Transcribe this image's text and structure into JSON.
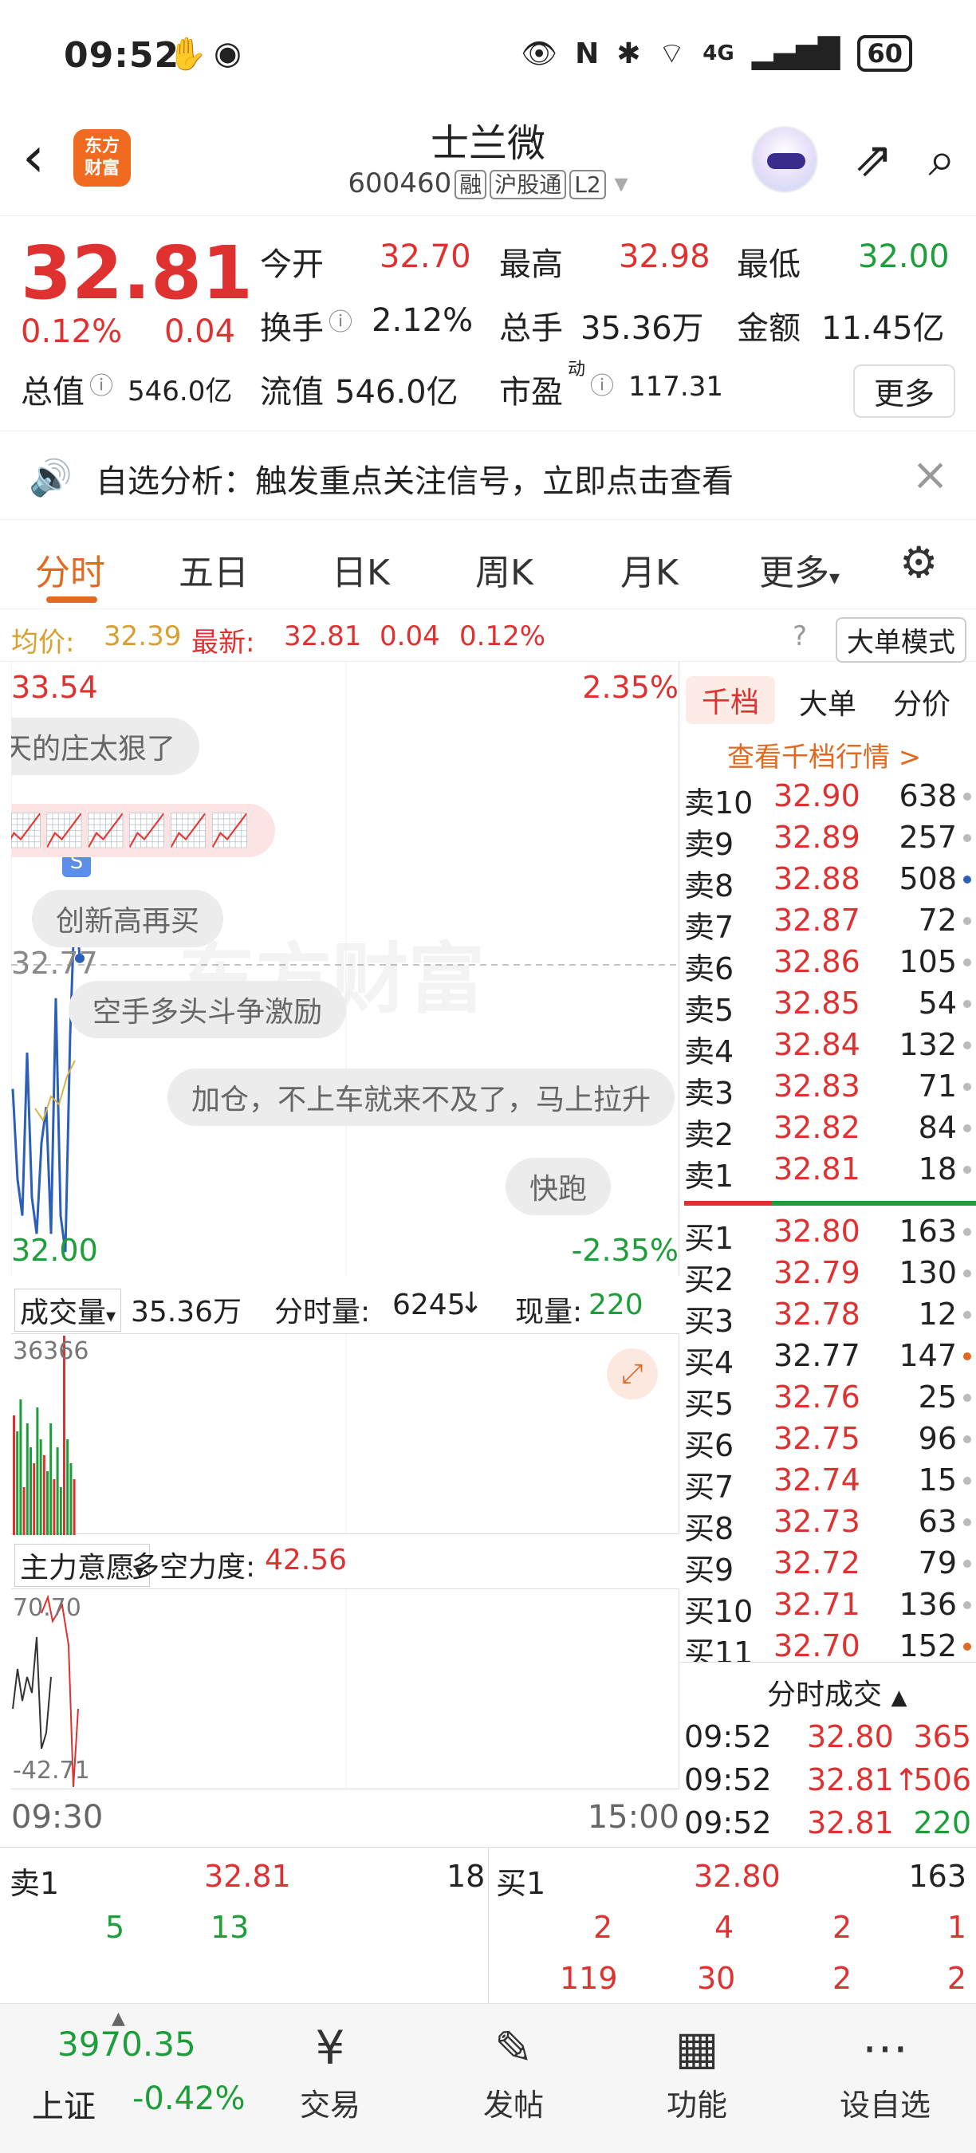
{
  "status_bar": {
    "time": "09:52",
    "network": "4G",
    "battery": "60"
  },
  "header": {
    "logo_line1": "东方",
    "logo_line2": "财富",
    "title": "士兰微",
    "code": "600460",
    "tags": [
      "融",
      "沪股通",
      "L2"
    ]
  },
  "quote": {
    "price": "32.81",
    "pct": "0.12%",
    "change": "0.04",
    "open_label": "今开",
    "open": "32.70",
    "high_label": "最高",
    "high": "32.98",
    "low_label": "最低",
    "low": "32.00",
    "turnover_label": "换手",
    "turnover": "2.12%",
    "volume_label": "总手",
    "volume": "35.36万",
    "amount_label": "金额",
    "amount": "11.45亿",
    "mktcap_label": "总值",
    "mktcap": "546.0亿",
    "float_label": "流值",
    "float": "546.0亿",
    "pe_label": "市盈",
    "pe_sup": "动",
    "pe": "117.31",
    "more": "更多"
  },
  "notice": {
    "text": "自选分析：触发重点关注信号，立即点击查看"
  },
  "tabs": [
    "分时",
    "五日",
    "日K",
    "周K",
    "月K",
    "更多"
  ],
  "avg_bar": {
    "avg_label": "均价:",
    "avg": "32.39",
    "latest_label": "最新:",
    "latest": "32.81",
    "chg": "0.04",
    "pct": "0.12%",
    "mode": "大单模式"
  },
  "chart": {
    "top_price": "33.54",
    "top_pct": "2.35%",
    "mid_price": "32.77",
    "bottom_price": "32.00",
    "bottom_pct": "-2.35%",
    "badge": "S",
    "watermark": "东方财富",
    "bubbles": [
      "天的庄太狠了",
      "创新高再买",
      "空手多头斗争激励",
      "加仓，不上车就来不及了，马上拉升",
      "快跑"
    ]
  },
  "volume_section": {
    "selector": "成交量",
    "total": "35.36万",
    "tick_label": "分时量:",
    "tick": "6245",
    "now_label": "现量:",
    "now": "220",
    "max": "36366"
  },
  "moneyflow_section": {
    "selector": "主力意愿",
    "strength_label": "多空力度:",
    "strength": "42.56",
    "top": "70.70",
    "bottom": "-42.71"
  },
  "time_axis": {
    "start": "09:30",
    "end": "15:00"
  },
  "orderbook": {
    "tabs": [
      "千档",
      "大单",
      "分价"
    ],
    "link": "查看千档行情 >",
    "asks": [
      {
        "label": "卖10",
        "price": "32.90",
        "vol": "638"
      },
      {
        "label": "卖9",
        "price": "32.89",
        "vol": "257"
      },
      {
        "label": "卖8",
        "price": "32.88",
        "vol": "508"
      },
      {
        "label": "卖7",
        "price": "32.87",
        "vol": "72"
      },
      {
        "label": "卖6",
        "price": "32.86",
        "vol": "105"
      },
      {
        "label": "卖5",
        "price": "32.85",
        "vol": "54"
      },
      {
        "label": "卖4",
        "price": "32.84",
        "vol": "132"
      },
      {
        "label": "卖3",
        "price": "32.83",
        "vol": "71"
      },
      {
        "label": "卖2",
        "price": "32.82",
        "vol": "84"
      },
      {
        "label": "卖1",
        "price": "32.81",
        "vol": "18"
      }
    ],
    "bids": [
      {
        "label": "买1",
        "price": "32.80",
        "vol": "163"
      },
      {
        "label": "买2",
        "price": "32.79",
        "vol": "130"
      },
      {
        "label": "买3",
        "price": "32.78",
        "vol": "12"
      },
      {
        "label": "买4",
        "price": "32.77",
        "vol": "147"
      },
      {
        "label": "买5",
        "price": "32.76",
        "vol": "25"
      },
      {
        "label": "买6",
        "price": "32.75",
        "vol": "96"
      },
      {
        "label": "买7",
        "price": "32.74",
        "vol": "15"
      },
      {
        "label": "买8",
        "price": "32.73",
        "vol": "63"
      },
      {
        "label": "买9",
        "price": "32.72",
        "vol": "79"
      },
      {
        "label": "买10",
        "price": "32.71",
        "vol": "136"
      },
      {
        "label": "买11",
        "price": "32.70",
        "vol": "152"
      }
    ],
    "ts_title": "分时成交",
    "trades": [
      {
        "time": "09:52",
        "price": "32.80",
        "vol": "365"
      },
      {
        "time": "09:52",
        "price": "32.81↑",
        "vol": "506"
      },
      {
        "time": "09:52",
        "price": "32.81",
        "vol": "220"
      }
    ]
  },
  "bottom_quote": {
    "ask_label": "卖1",
    "ask_price": "32.81",
    "ask_vol": "18",
    "bid_label": "买1",
    "bid_price": "32.80",
    "bid_vol": "163",
    "ask_row1": [
      "5",
      "13"
    ],
    "bid_row1": [
      "2",
      "4",
      "2",
      "1"
    ],
    "bid_row2": [
      "119",
      "30",
      "2",
      "2"
    ]
  },
  "bottom_nav": {
    "index_value": "3970.35",
    "index_name": "上证",
    "index_pct": "-0.42%",
    "items": [
      "交易",
      "发帖",
      "功能",
      "设自选"
    ]
  },
  "colors": {
    "up": "#e03131",
    "down": "#1e9e3a",
    "accent": "#e06a20",
    "line": "#2c5fb8",
    "avg": "#d8b44a"
  },
  "chart_data": {
    "type": "line",
    "ylim": [
      32.0,
      33.54
    ],
    "series": [
      {
        "values": [
          32.45,
          32.2,
          32.1,
          32.55,
          32.15,
          32.05,
          32.3,
          32.4,
          32.05,
          32.7,
          32.1,
          32.0,
          32.6,
          32.98,
          32.81
        ]
      }
    ]
  }
}
